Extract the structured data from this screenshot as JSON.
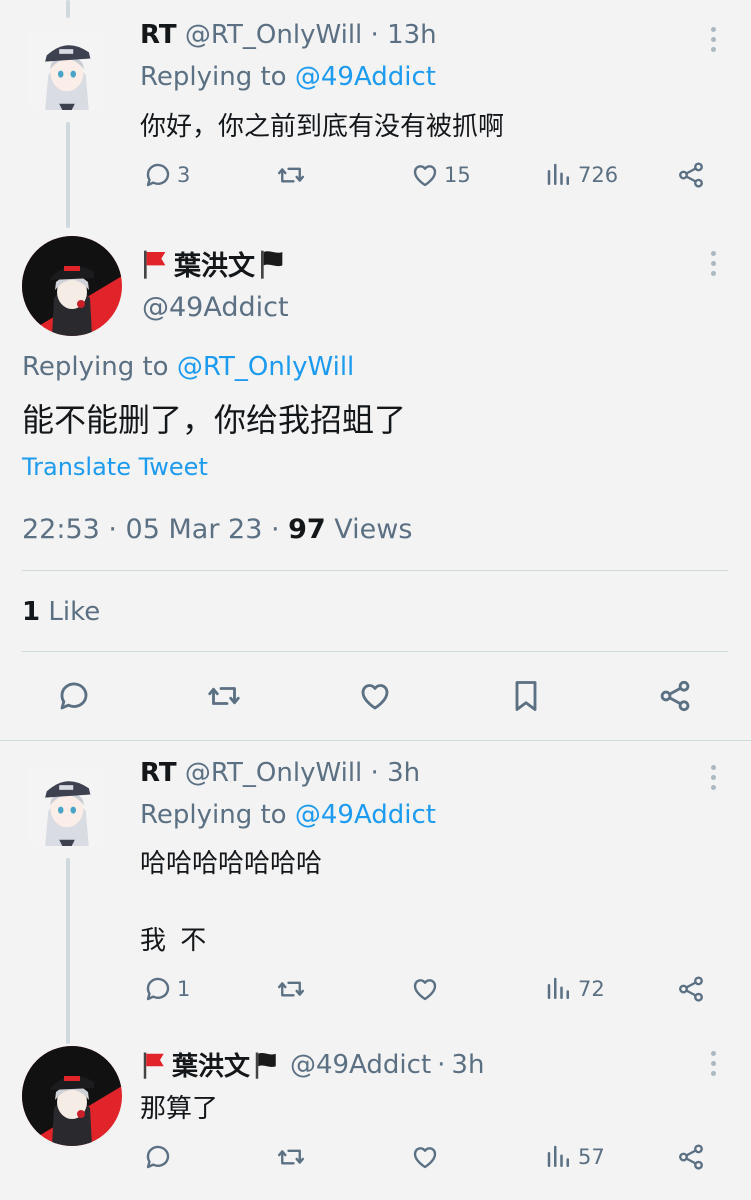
{
  "tweets": [
    {
      "name": "RT",
      "handle": "@RT_OnlyWill",
      "time": "13h",
      "replying_prefix": "Replying to",
      "replying_to": "@49Addict",
      "text": "你好，你之前到底有没有被抓啊",
      "replies": "3",
      "retweets": "",
      "likes": "15",
      "views": "726"
    },
    {
      "name": "葉洪文",
      "handle": "@49Addict",
      "replying_prefix": "Replying to",
      "replying_to": "@RT_OnlyWill",
      "text": "能不能删了，你给我招蛆了",
      "translate": "Translate Tweet",
      "datetime": "22:53 · 05 Mar 23 · ",
      "views_count": "97",
      "views_label": " Views",
      "likes_count": "1",
      "likes_label": " Like"
    },
    {
      "name": "RT",
      "handle": "@RT_OnlyWill",
      "time": "3h",
      "replying_prefix": "Replying to",
      "replying_to": "@49Addict",
      "text_line1": "哈哈哈哈哈哈哈",
      "text_line2": "我 不",
      "replies": "1",
      "views": "72"
    },
    {
      "name": "葉洪文",
      "handle": "@49Addict",
      "time": "3h",
      "text": "那算了",
      "views": "57"
    }
  ],
  "icons": {
    "reply": "reply-icon",
    "retweet": "retweet-icon",
    "like": "heart-icon",
    "views": "views-icon",
    "share": "share-icon",
    "bookmark": "bookmark-icon",
    "more": "more-icon",
    "flag_red": "red-flag-icon",
    "flag_black": "black-flag-icon"
  },
  "colors": {
    "accent": "#1d9bf0",
    "muted": "#5b7083",
    "background": "#f3f3f3",
    "divider": "#cfd9de"
  }
}
